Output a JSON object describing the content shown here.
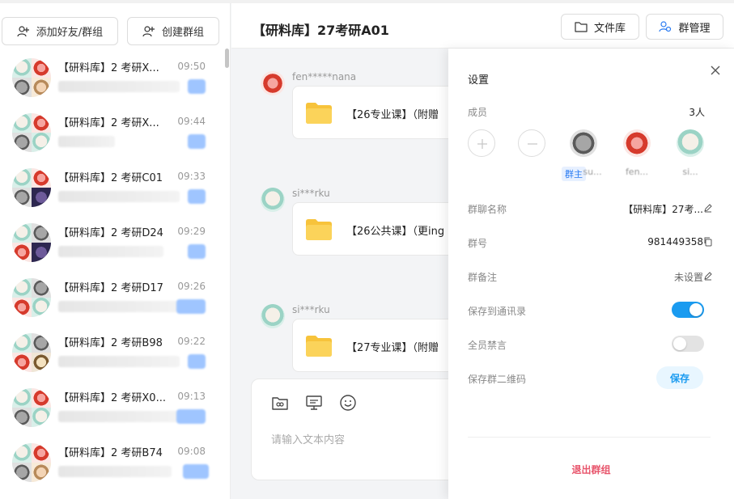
{
  "left_panel": {
    "add_friend_label": "添加好友/群组",
    "create_group_label": "创建群组",
    "conversations": [
      {
        "title": "【研料库】2  考研X...",
        "time": "09:50"
      },
      {
        "title": "【研料库】2  考研X...",
        "time": "09:44"
      },
      {
        "title": "【研料库】2  考研C01",
        "time": "09:33"
      },
      {
        "title": "【研料库】2  考研D24",
        "time": "09:29"
      },
      {
        "title": "【研料库】2  考研D17",
        "time": "09:26"
      },
      {
        "title": "【研料库】2  考研B98",
        "time": "09:22"
      },
      {
        "title": "【研料库】2  考研X0...",
        "time": "09:13"
      },
      {
        "title": "【研料库】2  考研B74",
        "time": "09:08"
      }
    ]
  },
  "chat": {
    "title": "【研料库】27考研A01",
    "files_label": "文件库",
    "manage_label": "群管理",
    "messages": [
      {
        "sender": "fen*****nana",
        "file": "【26专业课】（附赠"
      },
      {
        "sender": "si***rku",
        "file": "【26公共课】（更ing"
      },
      {
        "sender": "si***rku",
        "file": "【27专业课】（附赠"
      }
    ],
    "input_placeholder": "请输入文本内容"
  },
  "settings": {
    "title": "设置",
    "members_label": "成员",
    "members_count": "3人",
    "owner_tag": "群主",
    "member_names": [
      "su...",
      "fen...",
      "si..."
    ],
    "group_name_label": "群聊名称",
    "group_name_value": "【研料库】27考...",
    "group_number_label": "群号",
    "group_number_value": "981449358",
    "group_remark_label": "群备注",
    "group_remark_value": "未设置",
    "save_contacts_label": "保存到通讯录",
    "save_contacts_on": true,
    "mute_all_label": "全员禁言",
    "mute_all_on": false,
    "save_qr_label": "保存群二维码",
    "save_qr_button": "保存",
    "exit_label": "退出群组"
  },
  "colors": {
    "accent": "#1a9bf0",
    "exit": "#e8556c",
    "owner_tag": "#2a7bf2"
  },
  "icons": [
    "add-friend-icon",
    "create-group-icon",
    "folder-icon",
    "group-manage-icon",
    "file-folder-icon",
    "close-icon",
    "add-member-icon",
    "remove-member-icon",
    "edit-icon",
    "copy-icon",
    "files-tool-icon",
    "screen-tool-icon",
    "emoji-icon"
  ]
}
